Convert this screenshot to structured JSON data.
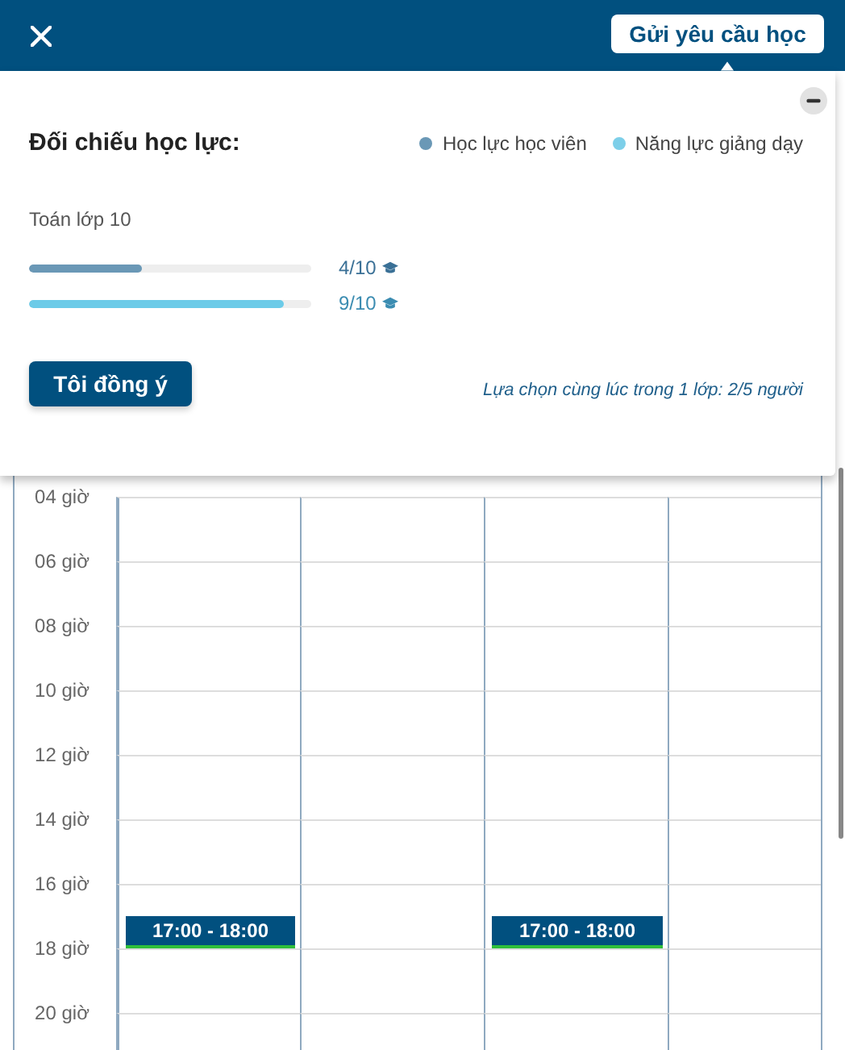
{
  "header": {
    "request_button": "Gửi yêu cầu học"
  },
  "panel": {
    "title": "Đối chiếu học lực:",
    "legend": [
      {
        "label": "Học lực học viên",
        "color": "#6a98b6"
      },
      {
        "label": "Năng lực giảng dạy",
        "color": "#7dcfe9"
      }
    ],
    "subject": "Toán lớp 10",
    "bars": [
      {
        "level": 0.4,
        "reading": "4/10",
        "color": "#6a98b6"
      },
      {
        "level": 0.9,
        "reading": "9/10",
        "color": "#6ccbe8"
      }
    ],
    "agree_button": "Tôi đồng ý",
    "note": "Lựa chọn cùng lúc trong 1 lớp: 2/5 người"
  },
  "calendar": {
    "rows": [
      {
        "label": "04 giờ"
      },
      {
        "label": "06 giờ"
      },
      {
        "label": "08 giờ"
      },
      {
        "label": "10 giờ"
      },
      {
        "label": "12 giờ"
      },
      {
        "label": "14 giờ"
      },
      {
        "label": "16 giờ",
        "cells": [
          {
            "kind": "event",
            "text": "17:00 - 18:00"
          },
          {
            "kind": "empty"
          },
          {
            "kind": "event",
            "text": "17:00 - 18:00"
          },
          {
            "kind": "empty"
          }
        ]
      },
      {
        "label": "18 giờ"
      },
      {
        "label": "20 giờ"
      }
    ]
  }
}
